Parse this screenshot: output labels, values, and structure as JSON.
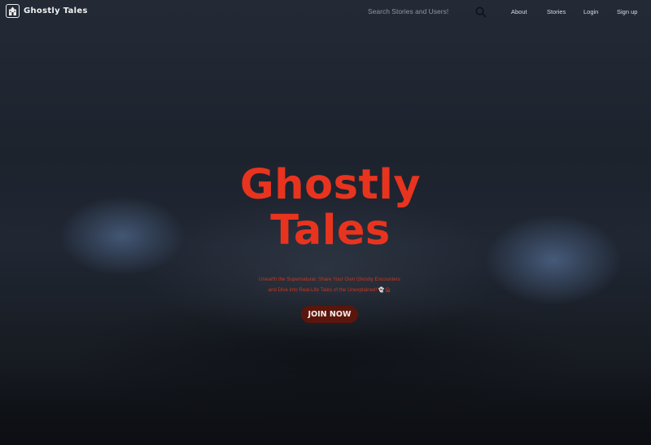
{
  "brand": {
    "name": "Ghostly Tales",
    "logo_icon": "ghost-castle-icon"
  },
  "search": {
    "placeholder": "Search Stories and Users!",
    "value": "",
    "icon": "search-icon"
  },
  "nav": {
    "links": [
      {
        "label": "About"
      },
      {
        "label": "Stories"
      },
      {
        "label": "Login"
      },
      {
        "label": "Sign up"
      }
    ]
  },
  "hero": {
    "title_line1": "Ghostly",
    "title_line2": "Tales",
    "tagline_line1": "Unearth the Supernatural: Share Your Own Ghostly Encounters",
    "tagline_line2": "and Dive into Real-Life Tales of the Unexplained! 👻🏚",
    "cta_label": "JOIN NOW"
  },
  "colors": {
    "accent": "#e8341f",
    "button_bg": "#5a160d",
    "background": "#1a1f28",
    "nav_text": "#d9dde3"
  }
}
